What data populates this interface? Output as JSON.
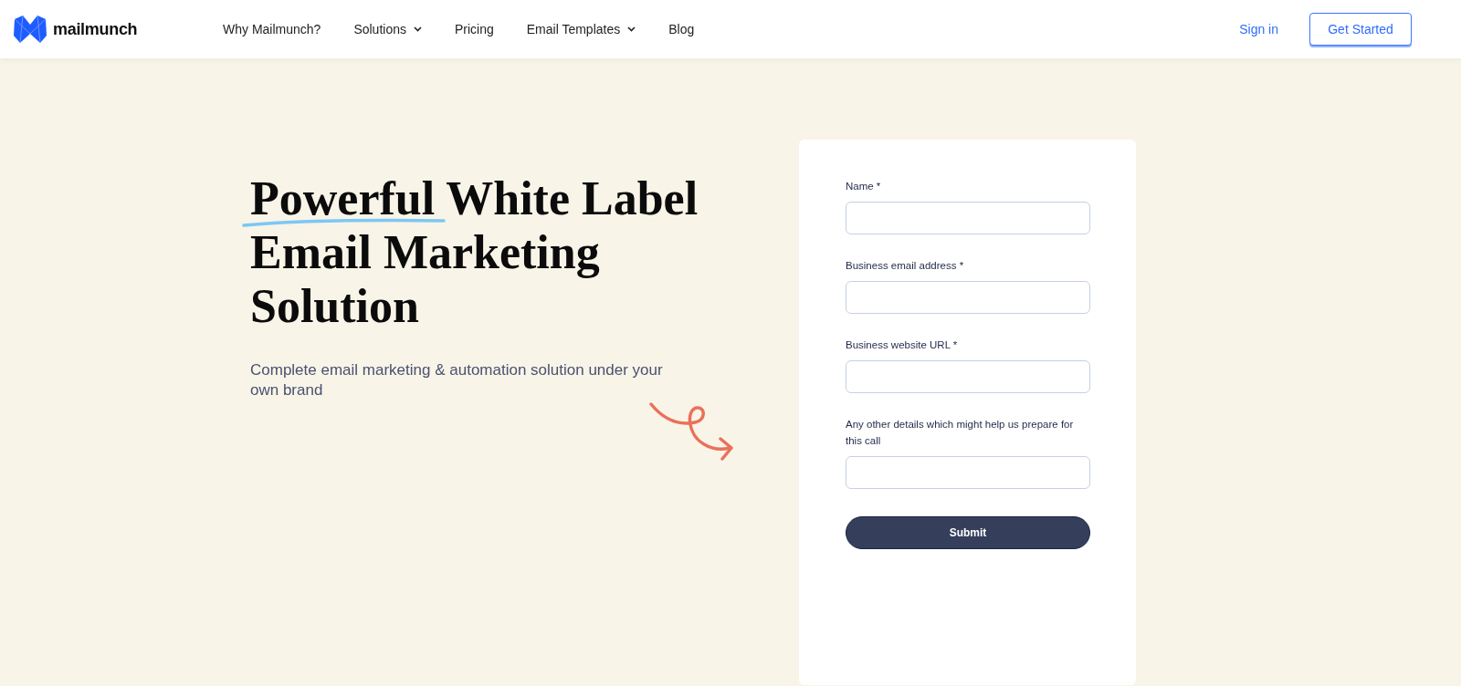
{
  "header": {
    "logo_text": "mailmunch",
    "nav": [
      {
        "label": "Why Mailmunch?",
        "has_menu": false
      },
      {
        "label": "Solutions",
        "has_menu": true
      },
      {
        "label": "Pricing",
        "has_menu": false
      },
      {
        "label": "Email Templates",
        "has_menu": true
      },
      {
        "label": "Blog",
        "has_menu": false
      }
    ],
    "sign_in": "Sign in",
    "cta": "Get Started"
  },
  "hero": {
    "headline": "Powerful White Label Email Marketing Solution",
    "subtitle": "Complete email marketing & automation solution under your own brand"
  },
  "form": {
    "fields": [
      {
        "label": "Name *"
      },
      {
        "label": "Business email address *"
      },
      {
        "label": "Business website URL *"
      },
      {
        "label": "Any other details which might help us prepare for this call"
      }
    ],
    "submit": "Submit"
  }
}
